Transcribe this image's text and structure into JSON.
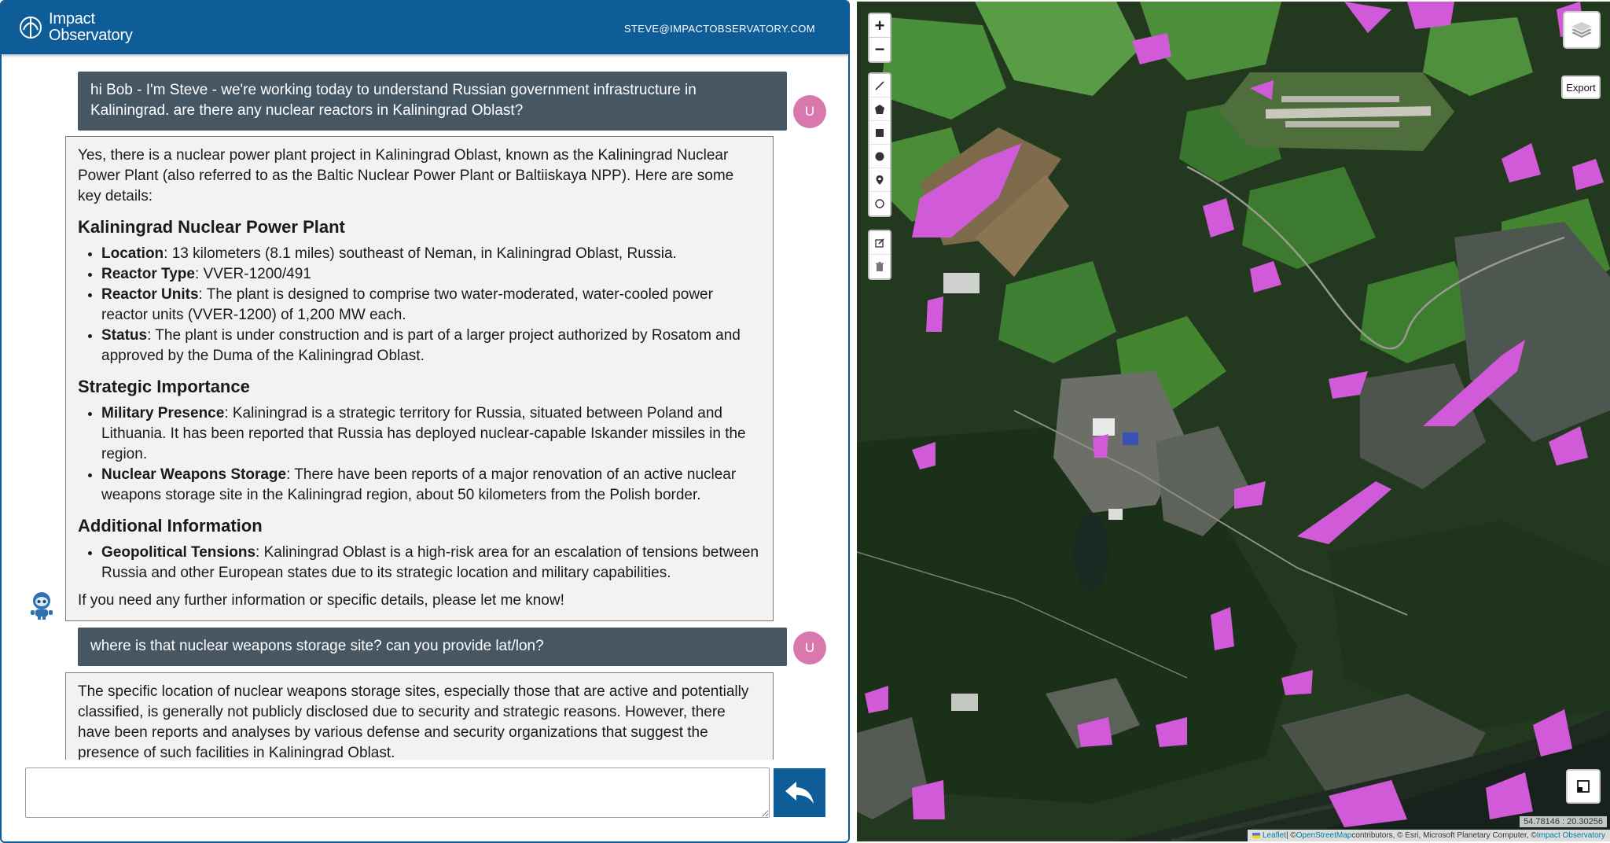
{
  "header": {
    "logo_line1": "Impact",
    "logo_line2": "Observatory",
    "user_email": "STEVE@IMPACTOBSERVATORY.COM"
  },
  "messages": {
    "user1": {
      "text": "hi Bob - I'm Steve - we're working today to understand Russian government infrastructure in Kaliningrad. are there any nuclear reactors in Kaliningrad Oblast?",
      "avatar": "U"
    },
    "bot1": {
      "intro": "Yes, there is a nuclear power plant project in Kaliningrad Oblast, known as the Kaliningrad Nuclear Power Plant (also referred to as the Baltic Nuclear Power Plant or Baltiiskaya NPP). Here are some key details:",
      "section1_title": "Kaliningrad Nuclear Power Plant",
      "section1_items": [
        {
          "term": "Location",
          "text": ": 13 kilometers (8.1 miles) southeast of Neman, in Kaliningrad Oblast, Russia."
        },
        {
          "term": "Reactor Type",
          "text": ": VVER-1200/491"
        },
        {
          "term": "Reactor Units",
          "text": ": The plant is designed to comprise two water-moderated, water-cooled power reactor units (VVER-1200) of 1,200 MW each."
        },
        {
          "term": "Status",
          "text": ": The plant is under construction and is part of a larger project authorized by Rosatom and approved by the Duma of the Kaliningrad Oblast."
        }
      ],
      "section2_title": "Strategic Importance",
      "section2_items": [
        {
          "term": "Military Presence",
          "text": ": Kaliningrad is a strategic territory for Russia, situated between Poland and Lithuania. It has been reported that Russia has deployed nuclear-capable Iskander missiles in the region."
        },
        {
          "term": "Nuclear Weapons Storage",
          "text": ": There have been reports of a major renovation of an active nuclear weapons storage site in the Kaliningrad region, about 50 kilometers from the Polish border."
        }
      ],
      "section3_title": "Additional Information",
      "section3_items": [
        {
          "term": "Geopolitical Tensions",
          "text": ": Kaliningrad Oblast is a high-risk area for an escalation of tensions between Russia and other European states due to its strategic location and military capabilities."
        }
      ],
      "closing": "If you need any further information or specific details, please let me know!"
    },
    "user2": {
      "text": "where is that nuclear weapons storage site? can you provide lat/lon?",
      "avatar": "U"
    },
    "bot2": {
      "text": "The specific location of nuclear weapons storage sites, especially those that are active and potentially classified, is generally not publicly disclosed due to security and strategic reasons. However, there have been reports and analyses by various defense and security organizations that suggest the presence of such facilities in Kaliningrad Oblast."
    }
  },
  "chat_input": {
    "value": "",
    "placeholder": ""
  },
  "send_icon": "reply-arrow-icon",
  "map": {
    "zoom_in": "+",
    "zoom_out": "−",
    "export_label": "Export",
    "coordinates": "54.78146 : 20.30256",
    "attribution": {
      "leaflet": "Leaflet",
      "sep1": " | © ",
      "osm": "OpenStreetMap",
      "rest": " contributors, © Esri, Microsoft Planetary Computer, © ",
      "impact": "Impact Observatory"
    },
    "draw_tools": [
      "polyline-icon",
      "polygon-icon",
      "rectangle-icon",
      "circle-icon",
      "marker-icon",
      "circle-marker-icon"
    ],
    "edit_tools": [
      "edit-icon",
      "delete-icon"
    ]
  },
  "colors": {
    "brand_blue": "#0f5d98",
    "user_bubble": "#475663",
    "user_avatar": "#d978ad",
    "highlight_magenta": "#d45ad4"
  }
}
